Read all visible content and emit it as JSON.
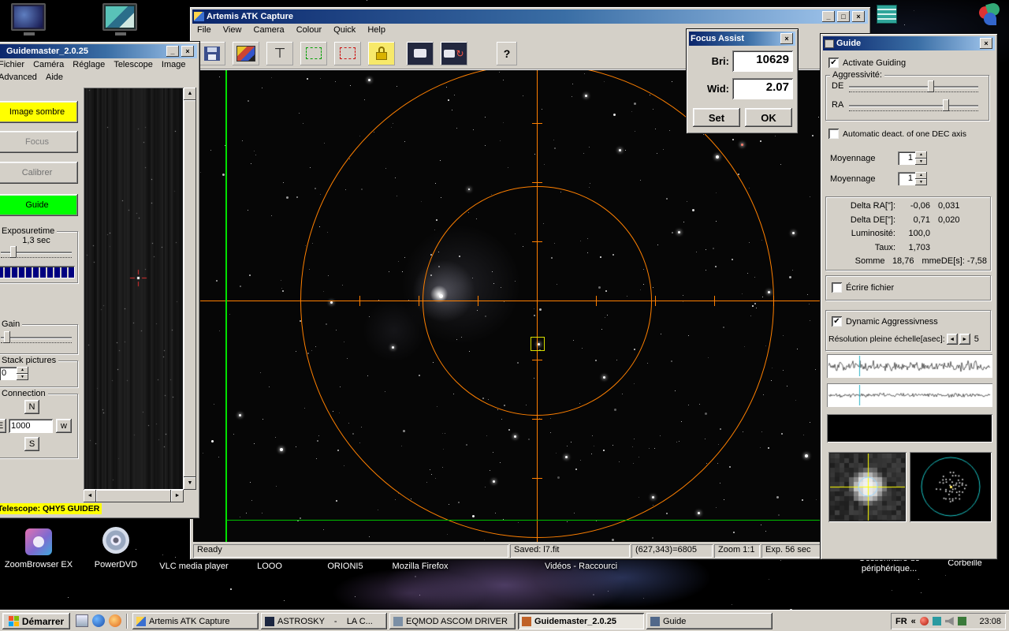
{
  "colors": {
    "titlebar_gradient_start": "#0a246a",
    "titlebar_gradient_end": "#a6caf0",
    "window_chrome": "#d4d0c8",
    "crosshair_orange": "#ff8000",
    "green_line": "#00e000",
    "guide_button_green": "#00ff00",
    "dark_frame_button_yellow": "#ffff00",
    "progress_blue": "#000080",
    "guide_cross_red": "#e03030"
  },
  "glyphs": {
    "minimize": "_",
    "maximize": "□",
    "close": "×",
    "check": "✔",
    "up": "▲",
    "down": "▼",
    "left": "◄",
    "right": "►",
    "question": "?",
    "chevron": "«",
    "refresh": "↻",
    "tool": "⊤"
  },
  "desktop": {
    "icons_bottom": [
      {
        "label": "ZoomBrowser EX"
      },
      {
        "label": "PowerDVD"
      },
      {
        "label": "VLC media player"
      },
      {
        "label": "LOOO"
      },
      {
        "label": "ORIONI5"
      },
      {
        "label": "Mozilla Firefox"
      },
      {
        "label": "Vidéos - Raccourci"
      },
      {
        "label": "Gestionnaire de périphérique..."
      },
      {
        "label": "Corbeille"
      }
    ]
  },
  "artemis": {
    "title": "Artemis ATK Capture",
    "menus": [
      {
        "label": "File"
      },
      {
        "label": "View"
      },
      {
        "label": "Camera"
      },
      {
        "label": "Colour"
      },
      {
        "label": "Quick"
      },
      {
        "label": "Help"
      }
    ],
    "status": {
      "ready": "Ready",
      "saved": "Saved: l7.fit",
      "pixel": "(627,343)=6805",
      "zoom": "Zoom 1:1",
      "exposure": "Exp. 56 sec"
    }
  },
  "focus_assist": {
    "title": "Focus Assist",
    "bri_label": "Bri:",
    "bri_value": "10629",
    "wid_label": "Wid:",
    "wid_value": "2.07",
    "set_label": "Set",
    "ok_label": "OK"
  },
  "guidemaster": {
    "title": "Guidemaster_2.0.25",
    "menus": [
      {
        "label": "Fichier"
      },
      {
        "label": "Caméra"
      },
      {
        "label": "Réglage"
      },
      {
        "label": "Telescope"
      },
      {
        "label": "Image"
      },
      {
        "label": "Advanced"
      },
      {
        "label": "Aide"
      }
    ],
    "btn_dark_frame": "Image sombre",
    "btn_focus": "Focus",
    "btn_calibrate": "Calibrer",
    "btn_guide": "Guide",
    "exposure_group": "Exposuretime",
    "exposure_value": "1,3 sec",
    "gain_group": "Gain",
    "stack_group": "Stack pictures",
    "stack_value": "0",
    "connection_group": "Connection",
    "btn_n": "N",
    "btn_e": "E",
    "btn_w": "w",
    "btn_s": "S",
    "pulse_value": "1000",
    "telescope_label": "Telescope: QHY5 GUIDER"
  },
  "guide": {
    "title": "Guide",
    "activate_label": "Activate Guiding",
    "aggress_group": "Aggressivité:",
    "de_label": "DE",
    "ra_label": "RA",
    "auto_deact_label": "Automatic deact. of one DEC axis",
    "moyennage1_label": "Moyennage",
    "moyennage1_value": "1",
    "moyennage2_label": "Moyennage",
    "moyennage2_value": "1",
    "stats": [
      {
        "label": "Delta RA[\"]:",
        "v1": "-0,06",
        "v2": "0,031"
      },
      {
        "label": "Delta DE[\"]:",
        "v1": "0,71",
        "v2": "0,020"
      },
      {
        "label": "Luminosité:",
        "v1": "100,0",
        "v2": ""
      },
      {
        "label": "Taux:",
        "v1": "1,703",
        "v2": ""
      },
      {
        "label": "Somme",
        "v1": "18,76",
        "v2": "mmeDE[s]: -7,58"
      }
    ],
    "write_file_label": "Écrire fichier",
    "dynamic_label": "Dynamic Aggressivness",
    "resolution_label": "Résolution pleine échelle[asec]:",
    "resolution_value": "5"
  },
  "taskbar": {
    "start_label": "Démarrer",
    "tasks": [
      {
        "label": "Artemis ATK Capture"
      },
      {
        "label": "ASTROSKY    -    LA C..."
      },
      {
        "label": "EQMOD ASCOM DRIVER"
      },
      {
        "label": "Guidemaster_2.0.25"
      },
      {
        "label": "Guide"
      }
    ],
    "lang": "FR",
    "time": "23:08"
  }
}
